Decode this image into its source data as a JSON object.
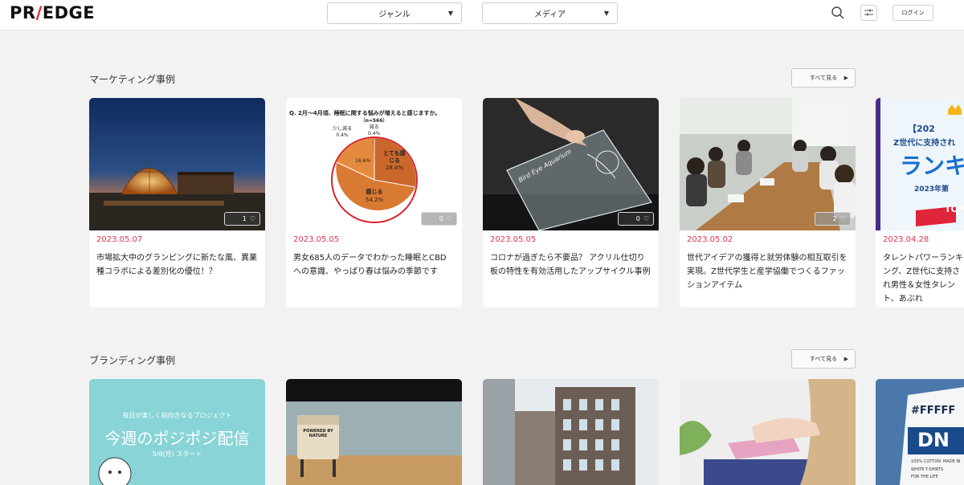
{
  "header": {
    "logo_left": "PR",
    "logo_slash": "/",
    "logo_right": "EDGE",
    "genre_label": "ジャンル",
    "media_label": "メディア",
    "login_label": "ログイン"
  },
  "marketing": {
    "title": "マーケティング事例",
    "see_all": "すべて見る",
    "cards": [
      {
        "date": "2023.05.07",
        "title": "市場拡大中のグランピングに新たな風、異業種コラボによる差別化の優位！？",
        "likes": "1"
      },
      {
        "date": "2023.05.05",
        "title": "男女685人のデータでわかった睡眠とCBDへの意識、やっぱり春は悩みの季節です",
        "likes": "0"
      },
      {
        "date": "2023.05.05",
        "title": "コロナが過ぎたら不要品？ アクリル仕切り板の特性を有効活用したアップサイクル事例",
        "likes": "0"
      },
      {
        "date": "2023.05.02",
        "title": "世代アイデアの獲得と就労体験の相互取引を実現。Z世代学生と産学協働でつくるファッションアイテム",
        "likes": "2"
      },
      {
        "date": "2023.04.28",
        "title": "タレントパワーランキング、Z世代に支持され男性＆女性タレント、あぶれ",
        "likes": ""
      }
    ],
    "pie": {
      "question": "Q. 2月～4月頃、睡眠に関する悩みが増えると感じますか。",
      "n": "（n=566）",
      "labels": [
        {
          "name": "とても感じる",
          "pct": "28.4%"
        },
        {
          "name": "感じる",
          "pct": "54.2%"
        },
        {
          "name": "",
          "pct": "16.6%"
        },
        {
          "name": "少し減る",
          "pct": "0.4%"
        },
        {
          "name": "減る",
          "pct": "0.4%"
        }
      ]
    },
    "acrylic_text": "Bird Eye Aquarium",
    "ranking": {
      "line1": "【202",
      "line2": "Z世代に支持され",
      "line3": "ランキ",
      "line4": "2023年第",
      "line5": "TOP"
    }
  },
  "branding": {
    "title": "ブランディング事例",
    "see_all": "すべて見る",
    "cards": [
      {
        "sub": "毎日が楽しく前向きなるプロジェクト",
        "headline": "今週のポジポジ配信",
        "date_text": "5/8(月) スタート"
      },
      {
        "sign_line1": "POWERED BY NATURE"
      },
      {},
      {},
      {
        "shirt_top": "#FFFFF",
        "shirt_mid": "DN",
        "shirt_small1": "100% COTTON",
        "shirt_small2": "MADE IN",
        "shirt_small3": "WHITE T-SHIRTS",
        "shirt_small4": "FOR THE LIFE"
      }
    ]
  },
  "colors": {
    "accent": "#e0334d",
    "logo_slash": "#e4242c",
    "bg": "#f2f2f2"
  }
}
